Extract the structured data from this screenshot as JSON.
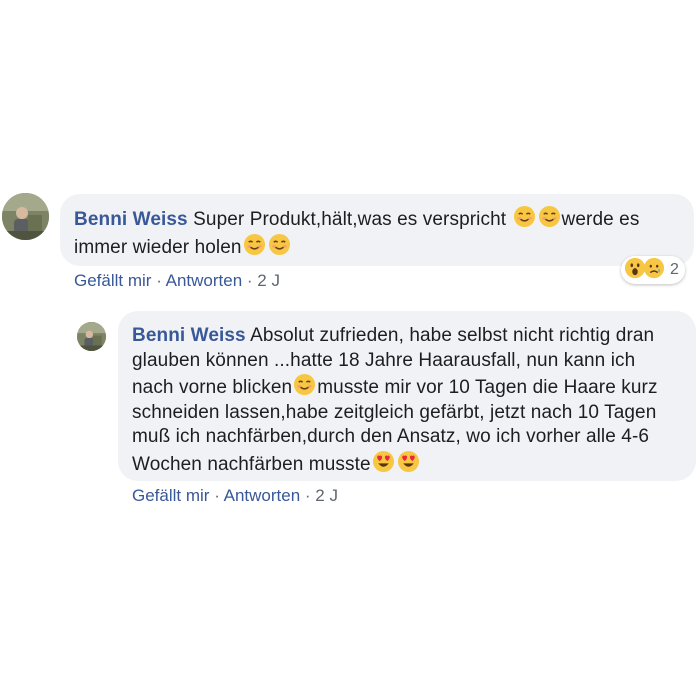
{
  "comments": [
    {
      "author": "Benni Weiss",
      "text_parts": [
        "Super Produkt,hält,was es verspricht ",
        "werde es immer wieder holen"
      ],
      "actions": {
        "like": "Gefällt mir",
        "sep1": " · ",
        "reply": "Antworten",
        "sep2": " · ",
        "age": "2 J"
      },
      "reactions": {
        "icons": [
          "wow-reaction",
          "sad-reaction"
        ],
        "count": "2"
      }
    },
    {
      "author": "Benni Weiss",
      "text_parts": [
        "Absolut zufrieden, habe selbst nicht richtig dran glauben können ...hatte 18 Jahre Haarausfall, nun kann ich nach vorne blicken",
        "musste mir vor 10 Tagen die Haare kurz schneiden lassen,habe zeitgleich gefärbt, jetzt nach 10 Tagen muß ich nachfärben,durch den Ansatz, wo ich vorher alle 4-6 Wochen nachfärben musste"
      ],
      "actions": {
        "like": "Gefällt mir",
        "sep1": " · ",
        "reply": "Antworten",
        "sep2": " · ",
        "age": "2 J"
      }
    }
  ],
  "colors": {
    "author": "#385898",
    "bubble": "#f0f2f5",
    "meta": "#606770"
  }
}
